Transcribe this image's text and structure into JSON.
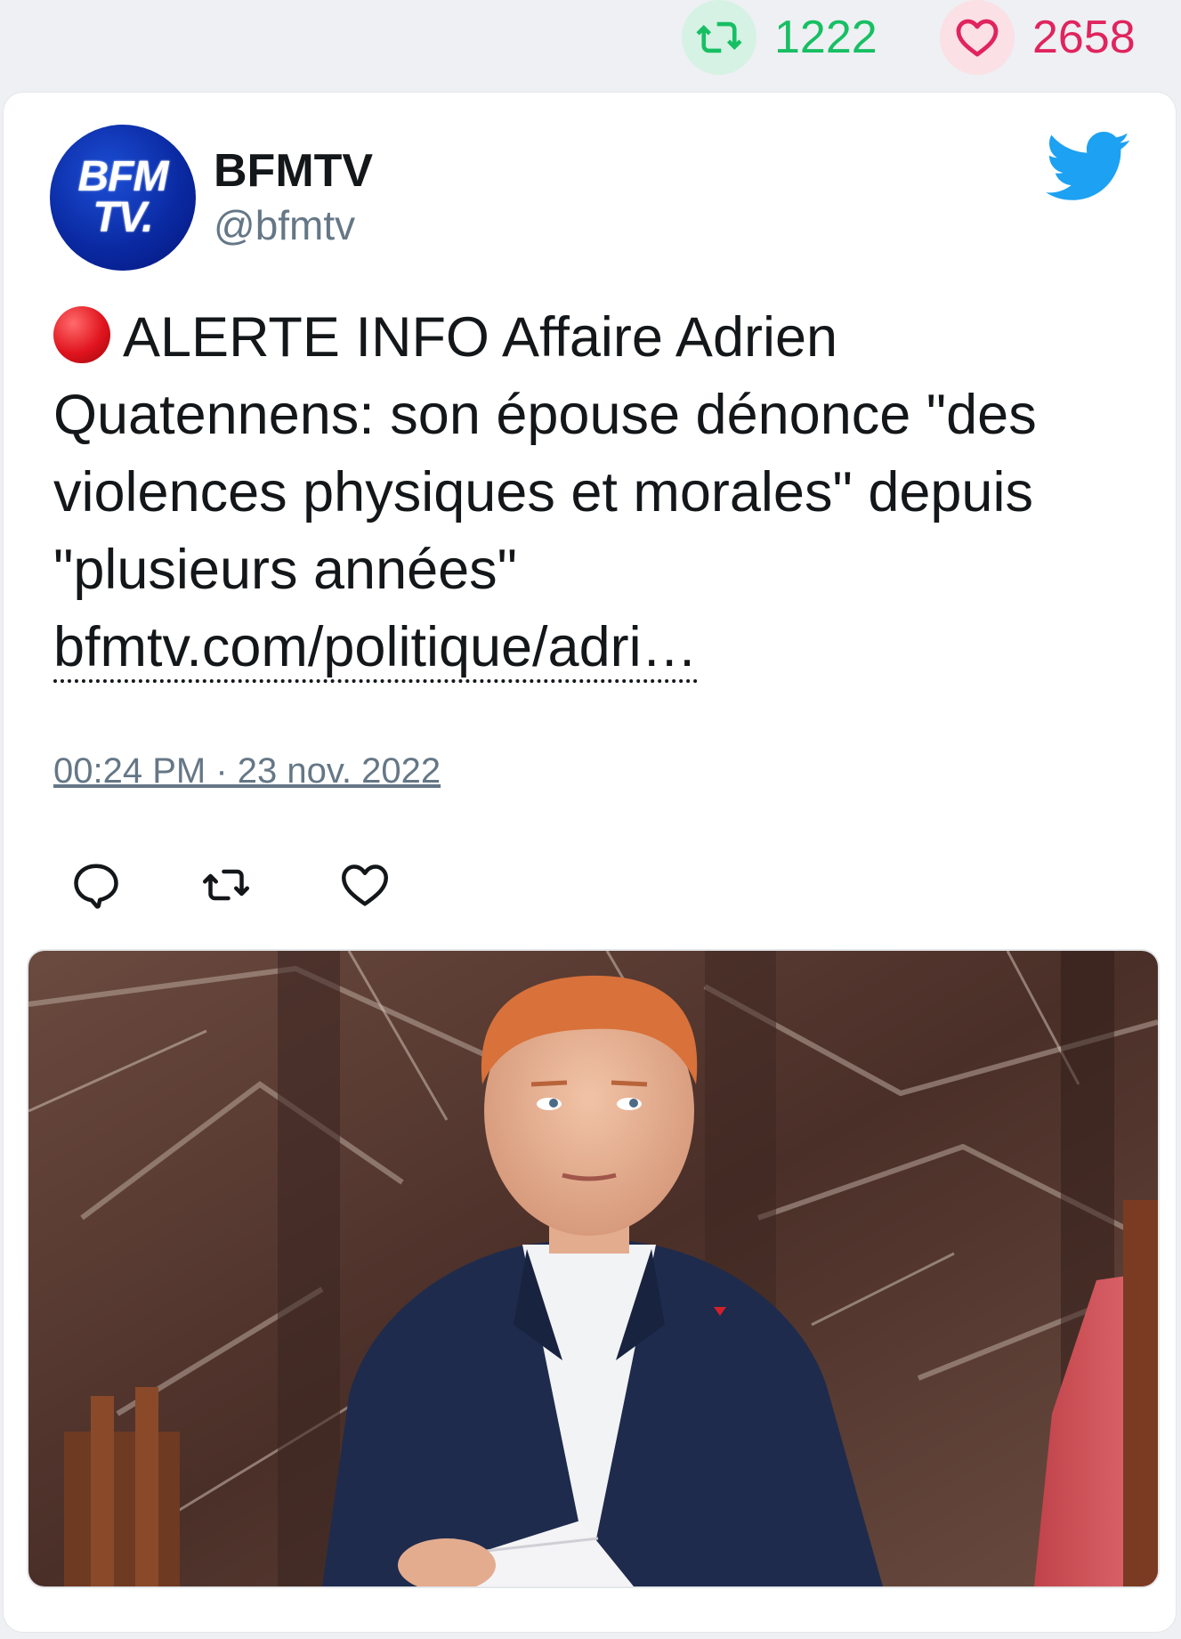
{
  "stats": {
    "retweets": "1222",
    "likes": "2658",
    "retweet_icon": "retweet-icon",
    "like_icon": "heart-icon"
  },
  "tweet": {
    "author_name": "BFMTV",
    "author_handle": "@bfmtv",
    "avatar_text_line1": "BFM",
    "avatar_text_line2": "TV.",
    "text": "ALERTE INFO Affaire Adrien Quatennens: son épouse dénonce \"des violences physiques et morales\" depuis \"plusieurs années\"",
    "link": "bfmtv.com/politique/adri…",
    "timestamp": "00:24 PM · 23 nov. 2022",
    "icons": [
      "red-circle-icon",
      "twitter-bird-icon",
      "reply-icon",
      "retweet-icon",
      "heart-icon"
    ]
  },
  "colors": {
    "retweet": "#17bf63",
    "like": "#e0245e",
    "twitter_blue": "#1da1f2",
    "muted": "#657786",
    "text": "#14171a"
  }
}
